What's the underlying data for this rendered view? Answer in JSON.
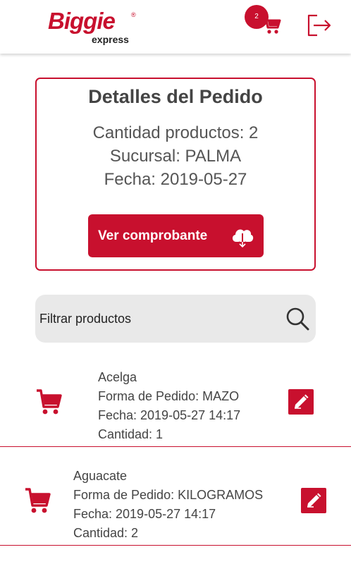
{
  "header": {
    "logo_main": "Biggie",
    "logo_registered": "®",
    "logo_sub": "express",
    "cart_count": "2",
    "cart_icon": "shopping-cart-icon",
    "logout_icon": "logout-icon"
  },
  "details": {
    "title": "Detalles del Pedido",
    "quantity": "Cantidad productos: 2",
    "branch": "Sucursal: PALMA",
    "date": "Fecha: 2019-05-27",
    "receipt_button": "Ver comprobante",
    "receipt_icon": "cloud-download-icon"
  },
  "filter": {
    "placeholder": "Filtrar productos",
    "icon": "search-icon"
  },
  "products": [
    {
      "name": "Acelga",
      "order_form": "Forma de Pedido: MAZO",
      "date": "Fecha: 2019-05-27 14:17",
      "quantity": "Cantidad: 1"
    },
    {
      "name": "Aguacate",
      "order_form": "Forma de Pedido: KILOGRAMOS",
      "date": "Fecha: 2019-05-27 14:17",
      "quantity": "Cantidad: 2"
    }
  ],
  "colors": {
    "brand": "#c8102e",
    "filter_bg": "#e9e9e9",
    "text": "#444444"
  }
}
